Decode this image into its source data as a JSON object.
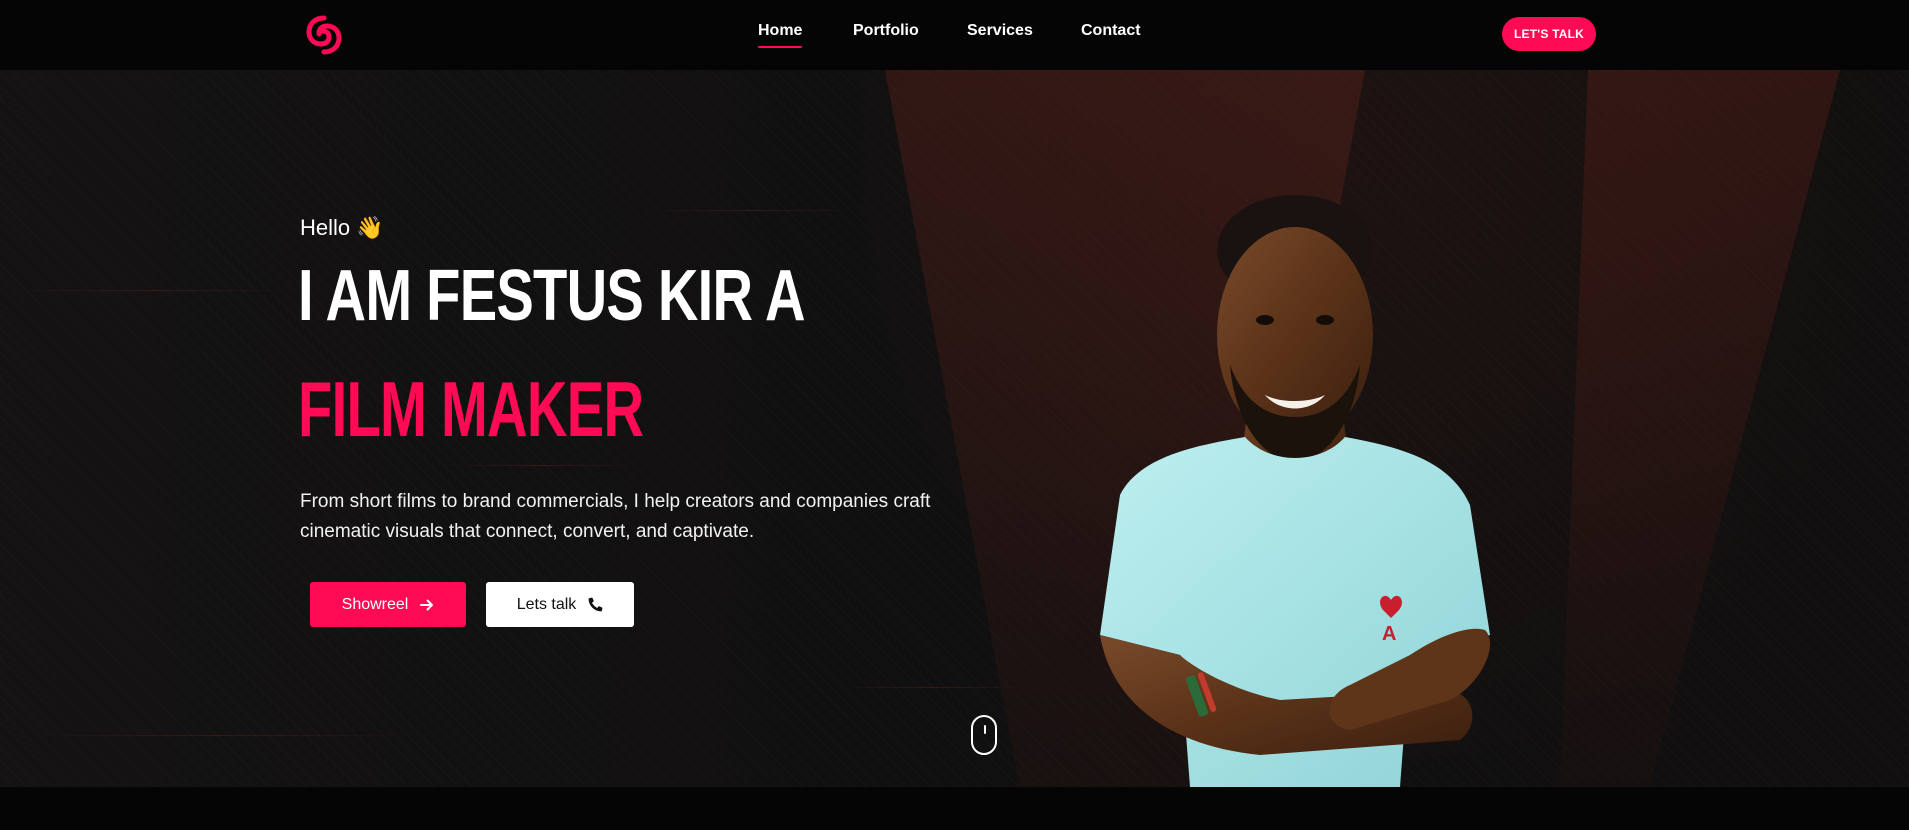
{
  "header": {
    "nav": [
      {
        "label": "Home",
        "active": true
      },
      {
        "label": "Portfolio",
        "active": false
      },
      {
        "label": "Services",
        "active": false
      },
      {
        "label": "Contact",
        "active": false
      }
    ],
    "cta_label": "LET'S TALK",
    "logo_icon": "swirl-logo-icon"
  },
  "hero": {
    "greeting": "Hello 👋",
    "headline": "I AM FESTUS KIR A",
    "role": "FILM MAKER",
    "intro": "From short films to brand commercials, I help creators and companies craft cinematic visuals that connect, convert, and captivate.",
    "buttons": {
      "showreel_label": "Showreel",
      "talk_label": "Lets talk"
    },
    "scroll_icon": "mouse-scroll-icon"
  },
  "colors": {
    "accent": "#ff0a54",
    "background": "#111010",
    "header": "#050505",
    "shirt": "#a9e4e6"
  }
}
